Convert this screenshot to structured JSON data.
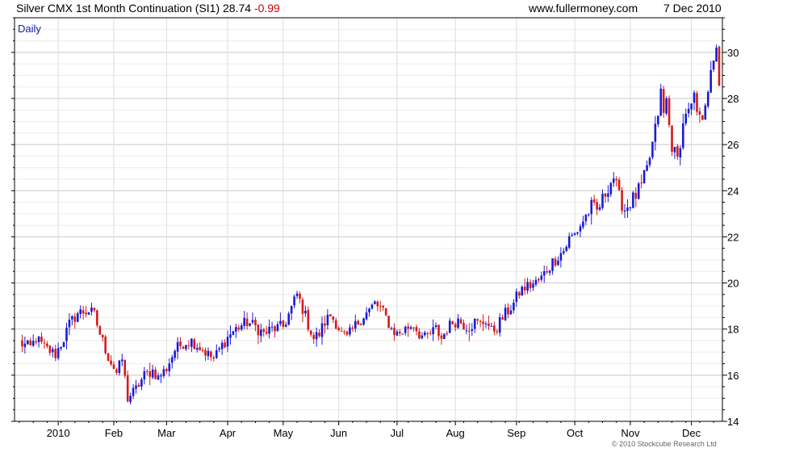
{
  "header": {
    "title": "Silver CMX 1st Month Continuation (SI1)",
    "last": "28.74",
    "change": "-0.99",
    "site": "www.fullermoney.com",
    "date": "7 Dec 2010"
  },
  "footer": {
    "copyright": "© 2010 Stockcube Research Ltd"
  },
  "colors": {
    "up": "#1a1ad6",
    "down": "#d61a1a",
    "grid": "#d8d8d8",
    "frame": "#000000",
    "period": "#1a1aa6"
  },
  "chart_data": {
    "type": "candlestick",
    "period_label": "Daily",
    "ylim": [
      14,
      31.5
    ],
    "yticks": [
      14,
      16,
      18,
      20,
      22,
      24,
      26,
      28,
      30
    ],
    "x_labels": [
      "2010",
      "Feb",
      "Mar",
      "Apr",
      "May",
      "Jun",
      "Jul",
      "Aug",
      "Sep",
      "Oct",
      "Nov",
      "Dec"
    ],
    "x_label_index": [
      14,
      34,
      53,
      75,
      95,
      115,
      136,
      157,
      179,
      200,
      220,
      242
    ],
    "grid": true,
    "close_path": [
      [
        0,
        17.4
      ],
      [
        4,
        17.2
      ],
      [
        6,
        17.6
      ],
      [
        9,
        17.2
      ],
      [
        13,
        16.9
      ],
      [
        16,
        17.6
      ],
      [
        18,
        18.2
      ],
      [
        21,
        18.7
      ],
      [
        25,
        18.8
      ],
      [
        27,
        18.6
      ],
      [
        29,
        17.8
      ],
      [
        32,
        16.8
      ],
      [
        35,
        16.1
      ],
      [
        37,
        16.7
      ],
      [
        39,
        15.0
      ],
      [
        42,
        15.4
      ],
      [
        45,
        16.0
      ],
      [
        48,
        16.2
      ],
      [
        50,
        15.9
      ],
      [
        53,
        16.3
      ],
      [
        56,
        17.1
      ],
      [
        59,
        17.4
      ],
      [
        62,
        17.5
      ],
      [
        64,
        17.3
      ],
      [
        67,
        17.0
      ],
      [
        70,
        16.7
      ],
      [
        73,
        17.3
      ],
      [
        76,
        17.8
      ],
      [
        79,
        18.1
      ],
      [
        82,
        18.3
      ],
      [
        85,
        18.1
      ],
      [
        88,
        17.8
      ],
      [
        91,
        18.0
      ],
      [
        95,
        18.1
      ],
      [
        98,
        18.9
      ],
      [
        100,
        19.5
      ],
      [
        102,
        18.9
      ],
      [
        104,
        18.2
      ],
      [
        106,
        17.6
      ],
      [
        108,
        17.8
      ],
      [
        110,
        18.3
      ],
      [
        112,
        18.6
      ],
      [
        114,
        18.3
      ],
      [
        116,
        17.8
      ],
      [
        118,
        17.6
      ],
      [
        120,
        18.0
      ],
      [
        122,
        18.3
      ],
      [
        124,
        18.6
      ],
      [
        126,
        18.8
      ],
      [
        128,
        19.1
      ],
      [
        130,
        18.9
      ],
      [
        132,
        18.5
      ],
      [
        134,
        18.0
      ],
      [
        136,
        17.8
      ],
      [
        138,
        17.9
      ],
      [
        140,
        18.1
      ],
      [
        142,
        18.2
      ],
      [
        144,
        17.8
      ],
      [
        146,
        17.6
      ],
      [
        148,
        17.8
      ],
      [
        150,
        18.0
      ],
      [
        152,
        17.6
      ],
      [
        154,
        18.0
      ],
      [
        156,
        18.3
      ],
      [
        158,
        18.4
      ],
      [
        160,
        18.2
      ],
      [
        162,
        18.1
      ],
      [
        164,
        18.3
      ],
      [
        166,
        18.2
      ],
      [
        168,
        18.4
      ],
      [
        170,
        17.9
      ],
      [
        172,
        18.1
      ],
      [
        174,
        18.5
      ],
      [
        176,
        18.8
      ],
      [
        178,
        19.1
      ],
      [
        180,
        19.6
      ],
      [
        182,
        19.8
      ],
      [
        184,
        19.9
      ],
      [
        186,
        20.0
      ],
      [
        188,
        20.2
      ],
      [
        190,
        20.6
      ],
      [
        192,
        20.9
      ],
      [
        194,
        21.2
      ],
      [
        196,
        21.4
      ],
      [
        198,
        21.9
      ],
      [
        200,
        22.1
      ],
      [
        202,
        22.5
      ],
      [
        204,
        22.9
      ],
      [
        206,
        23.3
      ],
      [
        208,
        23.1
      ],
      [
        210,
        23.6
      ],
      [
        212,
        24.2
      ],
      [
        214,
        24.6
      ],
      [
        216,
        23.7
      ],
      [
        218,
        23.2
      ],
      [
        220,
        23.5
      ],
      [
        222,
        23.8
      ],
      [
        224,
        24.2
      ],
      [
        226,
        24.9
      ],
      [
        228,
        26.0
      ],
      [
        229,
        26.6
      ],
      [
        230,
        27.4
      ],
      [
        231,
        28.2
      ],
      [
        232,
        27.3
      ],
      [
        233,
        27.9
      ],
      [
        234,
        26.8
      ],
      [
        235,
        26.0
      ],
      [
        236,
        25.6
      ],
      [
        237,
        25.3
      ],
      [
        238,
        26.2
      ],
      [
        239,
        26.8
      ],
      [
        240,
        27.5
      ],
      [
        241,
        27.3
      ],
      [
        242,
        27.6
      ],
      [
        243,
        27.9
      ],
      [
        244,
        27.4
      ],
      [
        245,
        27.0
      ],
      [
        246,
        27.3
      ],
      [
        247,
        28.0
      ],
      [
        248,
        28.5
      ],
      [
        249,
        28.9
      ],
      [
        250,
        29.4
      ],
      [
        251,
        30.4
      ],
      [
        252,
        28.7
      ]
    ]
  }
}
